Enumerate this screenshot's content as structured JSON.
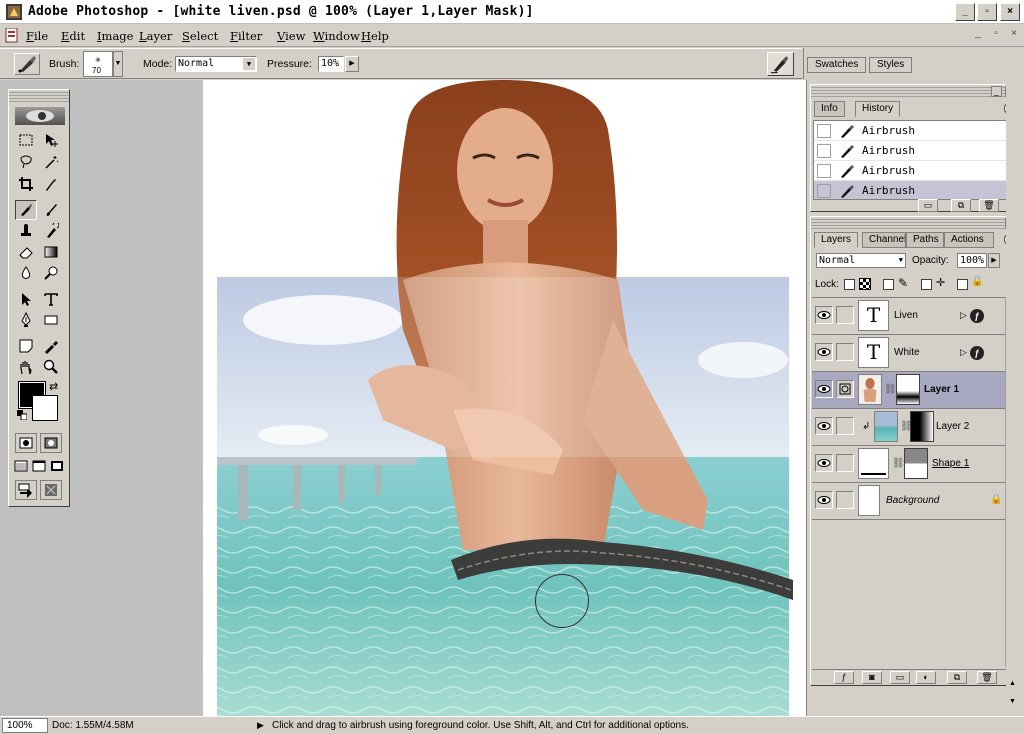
{
  "window": {
    "title": "Adobe Photoshop - [white liven.psd @ 100% (Layer 1,Layer Mask)]",
    "min_label": "_",
    "max_label": "▫",
    "close_label": "×"
  },
  "menu": {
    "items": [
      {
        "key": "F",
        "rest": "ile"
      },
      {
        "key": "E",
        "rest": "dit"
      },
      {
        "key": "I",
        "rest": "mage"
      },
      {
        "key": "L",
        "rest": "ayer"
      },
      {
        "key": "S",
        "rest": "elect"
      },
      {
        "key": "F",
        "rest": "ilter"
      },
      {
        "key": "V",
        "rest": "iew"
      },
      {
        "key": "W",
        "rest": "indow"
      },
      {
        "key": "H",
        "rest": "elp"
      }
    ],
    "doc_min": "_",
    "doc_restore": "▫",
    "doc_close": "×"
  },
  "options": {
    "brush_label": "Brush:",
    "brush_size": "70",
    "mode_label": "Mode:",
    "mode_value": "Normal",
    "pressure_label": "Pressure:",
    "pressure_value": "10%"
  },
  "palette_well": {
    "tabs": [
      "Swatches",
      "Styles"
    ]
  },
  "colors": {
    "foreground": "#000000",
    "background": "#ffffff",
    "selection": "#a8a8c0"
  },
  "history": {
    "tabs": [
      "Info",
      "History"
    ],
    "items": [
      {
        "label": "Airbrush",
        "icon": "airbrush-icon"
      },
      {
        "label": "Airbrush",
        "icon": "airbrush-icon"
      },
      {
        "label": "Airbrush",
        "icon": "airbrush-icon"
      },
      {
        "label": "Airbrush",
        "icon": "airbrush-icon",
        "selected": true
      }
    ]
  },
  "layers": {
    "tabs": [
      "Layers",
      "Channels",
      "Paths",
      "Actions"
    ],
    "blend_mode": "Normal",
    "opacity_label": "Opacity:",
    "opacity_value": "100%",
    "lock_label": "Lock:",
    "items": [
      {
        "name": "Liven",
        "type": "text",
        "thumb": "T"
      },
      {
        "name": "White",
        "type": "text",
        "thumb": "T"
      },
      {
        "name": "Layer 1",
        "type": "masked",
        "selected": true
      },
      {
        "name": "Layer 2",
        "type": "clipped"
      },
      {
        "name": "Shape 1",
        "type": "shape"
      },
      {
        "name": "Background",
        "type": "background"
      }
    ]
  },
  "status": {
    "zoom": "100%",
    "doc_size": "Doc: 1.55M/4.58M",
    "hint": "Click and drag to airbrush using foreground color.  Use Shift, Alt, and Ctrl for additional options."
  }
}
